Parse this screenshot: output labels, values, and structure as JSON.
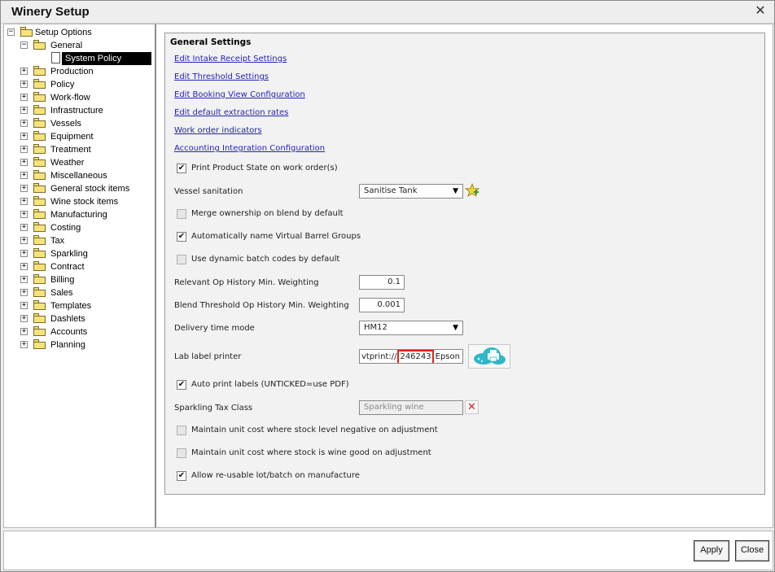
{
  "window": {
    "title": "Winery Setup",
    "close_glyph": "✕"
  },
  "tree": {
    "root": "Setup Options",
    "general": "General",
    "selected": "System Policy",
    "items": [
      "Production",
      "Policy",
      "Work-flow",
      "Infrastructure",
      "Vessels",
      "Equipment",
      "Treatment",
      "Weather",
      "Miscellaneous",
      "General stock items",
      "Wine stock items",
      "Manufacturing",
      "Costing",
      "Tax",
      "Sparkling",
      "Contract",
      "Billing",
      "Sales",
      "Templates",
      "Dashlets",
      "Accounts",
      "Planning"
    ]
  },
  "settings": {
    "section_title": "General Settings",
    "links": [
      "Edit Intake Receipt Settings",
      "Edit Threshold Settings",
      "Edit Booking View Configuration",
      "Edit default extraction rates",
      "Work order indicators",
      "Accounting Integration Configuration"
    ],
    "print_product_state": {
      "label": "Print Product State on work order(s)",
      "checked": true
    },
    "vessel_sanitation": {
      "label": "Vessel sanitation",
      "value": "Sanitise Tank"
    },
    "merge_ownership": {
      "label": "Merge ownership on blend by default",
      "checked": false
    },
    "auto_name_barrel": {
      "label": "Automatically name Virtual Barrel Groups",
      "checked": true
    },
    "dynamic_batch": {
      "label": "Use dynamic batch codes by default",
      "checked": false
    },
    "op_history": {
      "label": "Relevant Op History Min. Weighting",
      "value": "0.1"
    },
    "blend_threshold": {
      "label": "Blend Threshold Op History Min. Weighting",
      "value": "0.001"
    },
    "delivery_mode": {
      "label": "Delivery time mode",
      "value": "HM12"
    },
    "lab_printer": {
      "label": "Lab label printer",
      "prefix": "vtprint://",
      "highlight": "246243",
      "suffix": "Epson"
    },
    "auto_print": {
      "label": "Auto print labels (UNTICKED=use PDF)",
      "checked": true
    },
    "sparkling_tax": {
      "label": "Sparkling Tax Class",
      "placeholder": "Sparkling wine"
    },
    "maintain_negative": {
      "label": "Maintain unit cost where stock level negative on adjustment",
      "checked": false
    },
    "maintain_wine_good": {
      "label": "Maintain unit cost where stock is wine good on adjustment",
      "checked": false
    },
    "reusable_lot": {
      "label": "Allow re-usable lot/batch on manufacture",
      "checked": true
    }
  },
  "footer": {
    "apply": "Apply",
    "close": "Close"
  },
  "icons": {
    "add_star": "add-star-icon",
    "cloud_print": "cloud-print-icon",
    "clear": "clear-x-icon",
    "check_glyph": "✔"
  },
  "colors": {
    "link": "#2222bb",
    "highlight": "#e2231a",
    "cloud": "#2fb7c9"
  }
}
